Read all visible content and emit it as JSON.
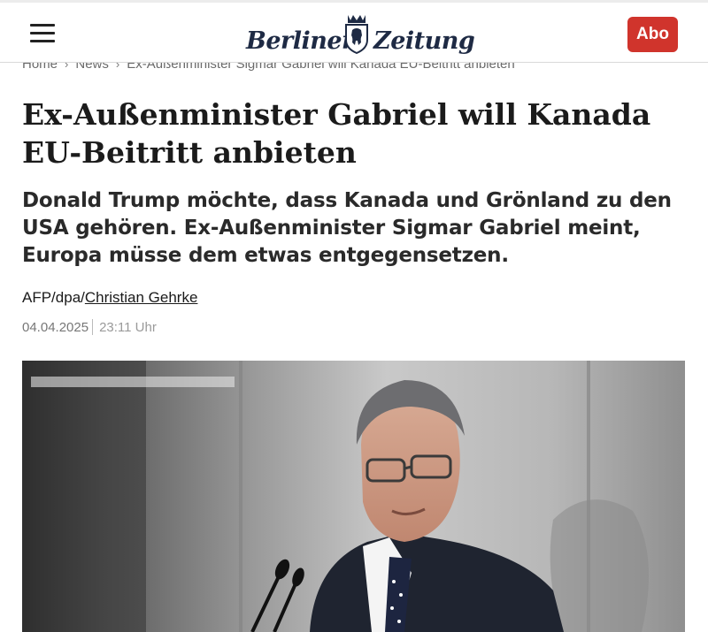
{
  "header": {
    "logo_text": "Berliner Zeitung",
    "abo_label": "Abo",
    "accent_color": "#d0342c"
  },
  "breadcrumb": {
    "items": [
      "Home",
      "News",
      "Ex-Außenminister Sigmar Gabriel will Kanada EU-Beitritt anbieten"
    ]
  },
  "article": {
    "headline": "Ex-Außenminister Gabriel will Kanada EU-Beitritt anbieten",
    "lead": "Donald Trump möchte, dass Kanada und Grönland zu den USA gehören. Ex-Außenminister Sigmar Gabriel meint, Europa müsse dem etwas entgegensetzen.",
    "author_prefix": "AFP/dpa/",
    "author_name": "Christian Gehrke",
    "date": "04.04.2025",
    "time": "23:11 Uhr"
  }
}
